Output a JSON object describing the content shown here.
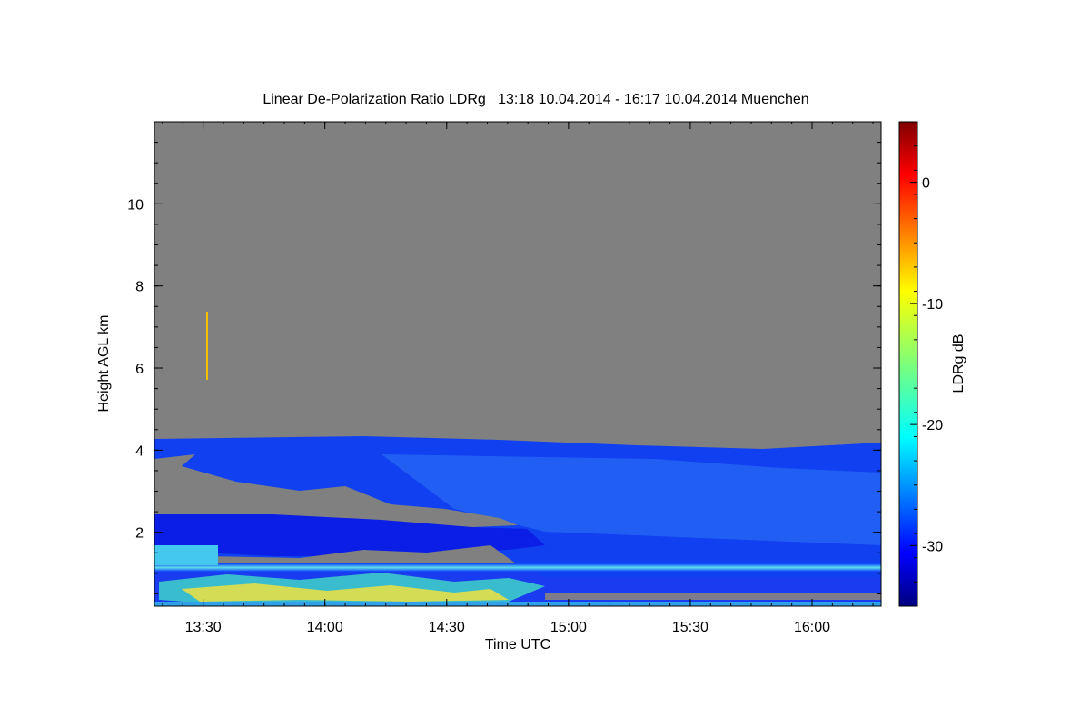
{
  "chart_data": {
    "type": "heatmap",
    "title": "Linear De-Polarization Ratio LDRg   13:18 10.04.2014 - 16:17 10.04.2014 Muenchen",
    "xlabel": "Time UTC",
    "ylabel": "Height AGL km",
    "colorbar_label": "LDRg dB",
    "x_range": [
      "13:18",
      "16:17"
    ],
    "x_ticks": [
      "13:30",
      "14:00",
      "14:30",
      "15:00",
      "15:30",
      "16:00"
    ],
    "y_range": [
      0.2,
      12.0
    ],
    "y_ticks": [
      2,
      4,
      6,
      8,
      10
    ],
    "colorbar_range": [
      -35,
      5
    ],
    "colorbar_ticks": [
      0,
      -10,
      -20,
      -30
    ],
    "no_signal_color": "#808080",
    "colormap": "jet",
    "features": [
      {
        "name": "cloud/aerosol layer top",
        "height_km_start": 4.2,
        "height_km_end": 4.0,
        "ldr_db": -31
      },
      {
        "name": "inner layer",
        "height_km": [
          1.2,
          2.4
        ],
        "ldr_db": -27
      },
      {
        "name": "bright aerosol band",
        "height_km": 1.1,
        "ldr_db": -22
      },
      {
        "name": "near-ground layer",
        "height_km": [
          0.3,
          1.0
        ],
        "ldr_db": -12
      }
    ]
  }
}
